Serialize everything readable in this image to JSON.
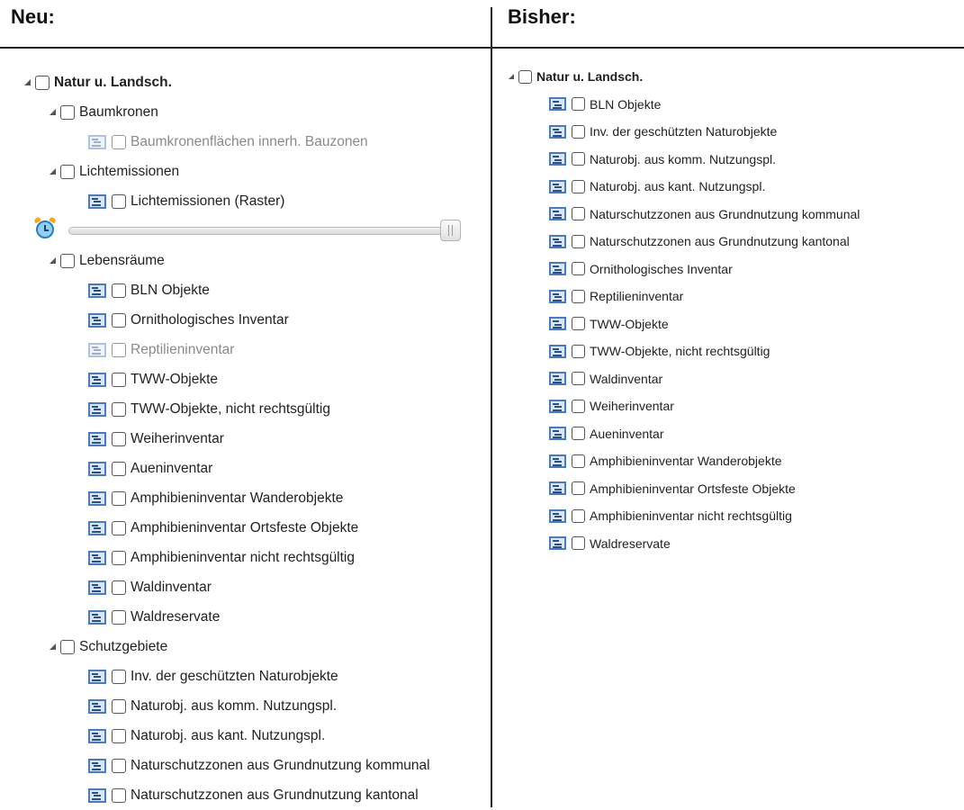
{
  "headers": {
    "new": "Neu:",
    "old": "Bisher:"
  },
  "new_tree": {
    "root": "Natur u. Landsch.",
    "groups": {
      "baumkronen": {
        "label": "Baumkronen",
        "items": [
          "Baumkronenflächen innerh. Bauzonen"
        ]
      },
      "lichtemissionen": {
        "label": "Lichtemissionen",
        "items": [
          "Lichtemissionen (Raster)"
        ]
      },
      "lebensraeume": {
        "label": "Lebensräume",
        "items": [
          "BLN Objekte",
          "Ornithologisches Inventar",
          "Reptilieninventar",
          "TWW-Objekte",
          "TWW-Objekte, nicht rechtsgültig",
          "Weiherinventar",
          "Aueninventar",
          "Amphibieninventar Wanderobjekte",
          "Amphibieninventar Ortsfeste Objekte",
          "Amphibieninventar nicht rechtsgültig",
          "Waldinventar",
          "Waldreservate"
        ]
      },
      "schutzgebiete": {
        "label": "Schutzgebiete",
        "items": [
          "Inv. der geschützten Naturobjekte",
          "Naturobj. aus komm. Nutzungspl.",
          "Naturobj. aus kant. Nutzungspl.",
          "Naturschutzzonen aus Grundnutzung kommunal",
          "Naturschutzzonen aus Grundnutzung kantonal"
        ]
      }
    },
    "time_slider": {
      "value_fraction": 1.0
    }
  },
  "old_tree": {
    "root": "Natur u. Landsch.",
    "items": [
      "BLN Objekte",
      "Inv. der geschützten Naturobjekte",
      "Naturobj. aus komm. Nutzungspl.",
      "Naturobj. aus kant. Nutzungspl.",
      "Naturschutzzonen aus Grundnutzung kommunal",
      "Naturschutzzonen aus Grundnutzung kantonal",
      "Ornithologisches Inventar",
      "Reptilieninventar",
      "TWW-Objekte",
      "TWW-Objekte, nicht rechtsgültig",
      "Waldinventar",
      "Weiherinventar",
      "Aueninventar",
      "Amphibieninventar Wanderobjekte",
      "Amphibieninventar Ortsfeste Objekte",
      "Amphibieninventar nicht rechtsgültig",
      "Waldreservate"
    ]
  },
  "icons": {
    "expand": "expanded-triangle-icon",
    "legend": "legend-icon",
    "timer": "alarm-clock-icon"
  },
  "colors": {
    "legend_blue": "#4a7bc0",
    "disabled_text": "#8a8a8a"
  }
}
